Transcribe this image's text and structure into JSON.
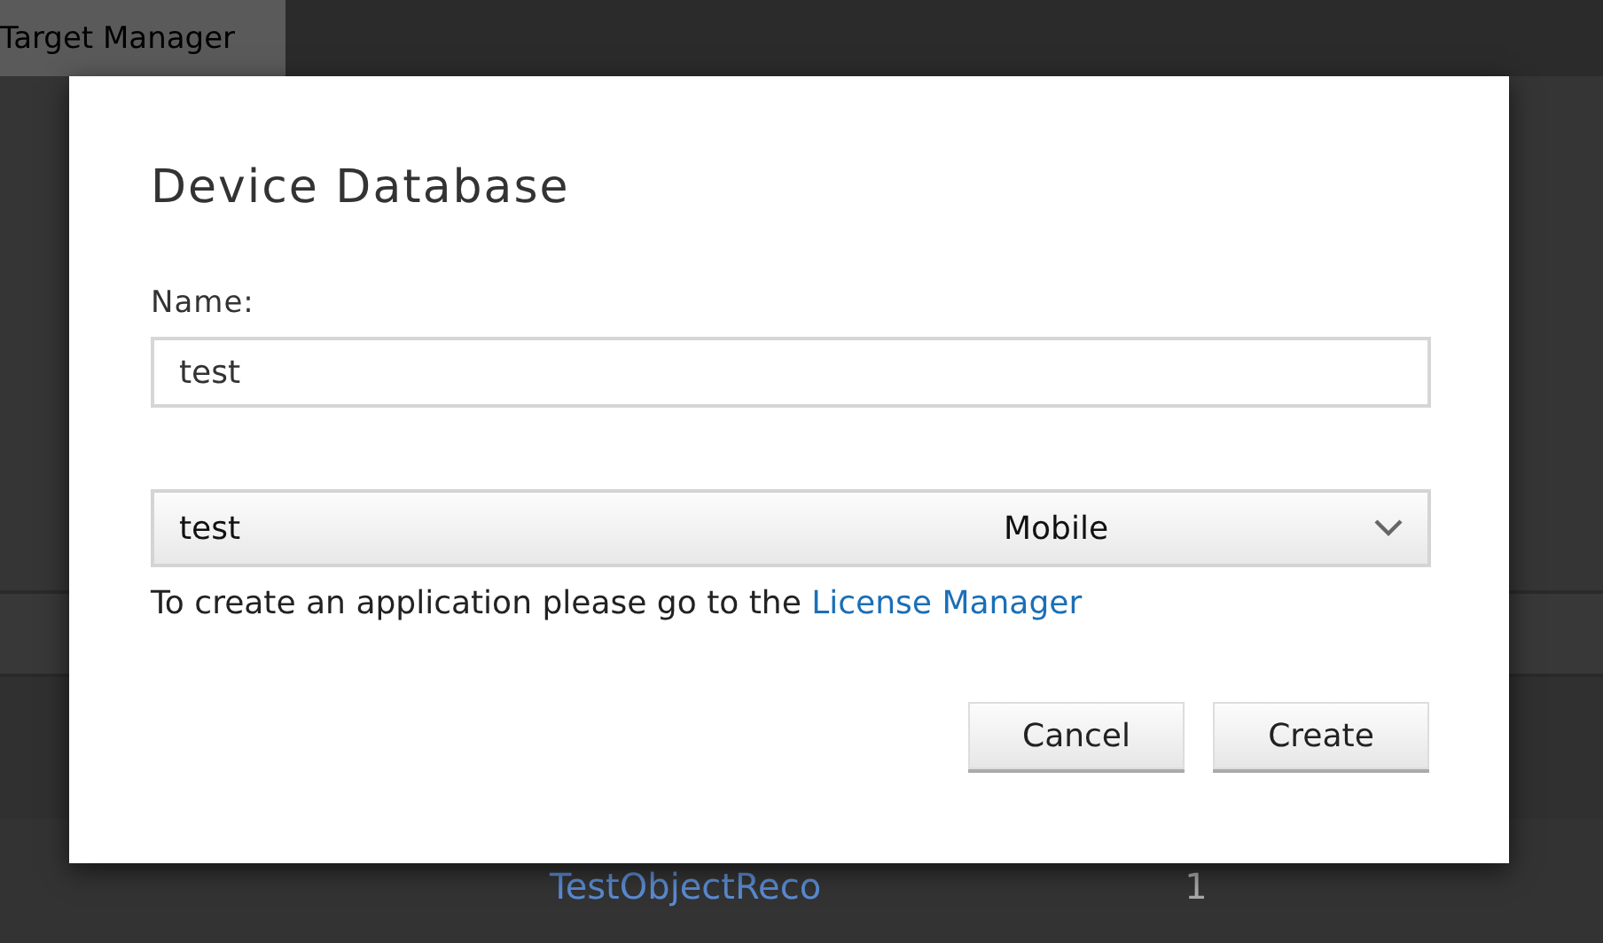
{
  "background": {
    "tab": "Target Manager",
    "row": {
      "name": "TestObjectReco",
      "count": "1"
    }
  },
  "dialog": {
    "title": "Device Database",
    "name_label": "Name:",
    "name_value": "test",
    "select": {
      "value": "test",
      "type": "Mobile"
    },
    "help": {
      "text": "To create an application please go to the ",
      "link": "License Manager"
    },
    "buttons": [
      {
        "label": "Cancel"
      },
      {
        "label": "Create"
      }
    ]
  }
}
